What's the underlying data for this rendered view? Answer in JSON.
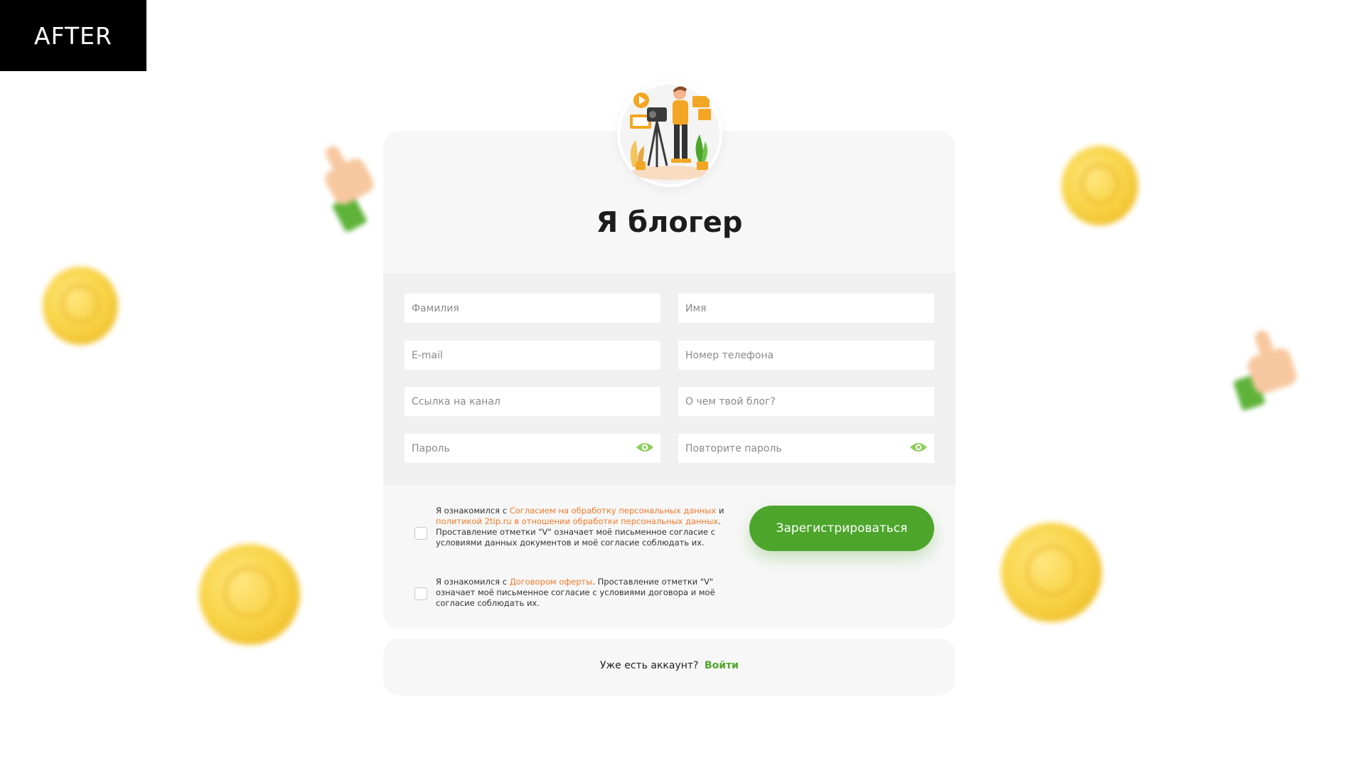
{
  "badge": "AFTER",
  "title": "Я блогер",
  "fields": {
    "last_name": "Фамилия",
    "first_name": "Имя",
    "email": "E-mail",
    "phone": "Номер телефона",
    "channel": "Ссылка на канал",
    "blog_topic": "О чем твой блог?",
    "password": "Пароль",
    "password_repeat": "Повторите пароль"
  },
  "consent1": {
    "p1": "Я ознакомился с ",
    "link1": "Согласием на обработку персональных данных",
    "p2": " и ",
    "link2": "политикой 2tip.ru в отношении обработки персональных данных",
    "p3": ". Проставление отметки \"V\" означает моё письменное согласие с условиями данных документов и моё согласие соблюдать их."
  },
  "consent2": {
    "p1": "Я ознакомился с ",
    "link1": "Договором оферты",
    "p2": ". Проставление отметки \"V\" означает моё письменное согласие с условиями договора и моё согласие соблюдать их."
  },
  "register_button": "Зарегистрироваться",
  "login": {
    "question": "Уже есть аккаунт?",
    "link": "Войти"
  },
  "colors": {
    "accent": "#4da62b",
    "link": "#f47a2a",
    "card": "#f7f7f7",
    "fields_band": "#f0f0f0"
  },
  "icons": [
    "eye-icon",
    "blogger-illustration",
    "coin-decoration",
    "thumbs-up-decoration"
  ]
}
